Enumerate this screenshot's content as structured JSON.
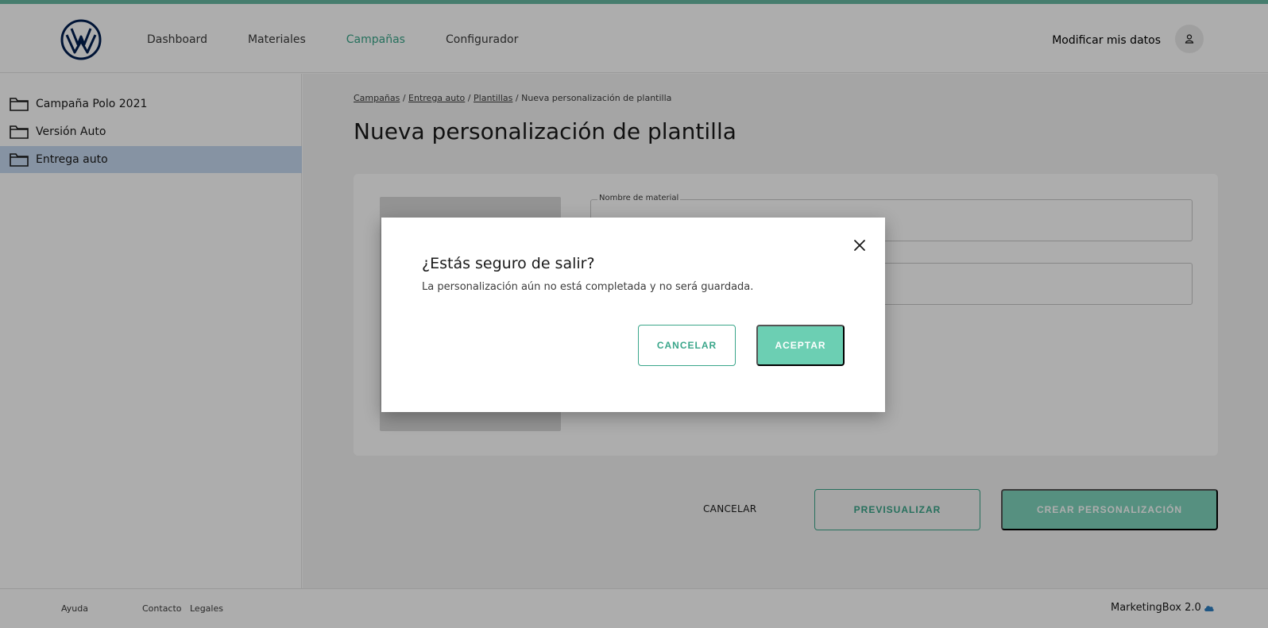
{
  "header": {
    "nav": [
      {
        "label": "Dashboard"
      },
      {
        "label": "Materiales"
      },
      {
        "label": "Campañas"
      },
      {
        "label": "Configurador"
      }
    ],
    "active_nav": "Campañas",
    "user_link": "Modificar mis datos"
  },
  "sidebar": {
    "items": [
      {
        "label": "Campaña Polo 2021"
      },
      {
        "label": "Versión Auto"
      },
      {
        "label": "Entrega auto"
      }
    ],
    "selected": "Entrega auto"
  },
  "breadcrumb": {
    "items": [
      "Campañas",
      "Entrega auto",
      "Plantillas"
    ],
    "separator": "/",
    "current": "Nueva personalización de plantilla"
  },
  "page": {
    "title": "Nueva personalización de plantilla"
  },
  "form": {
    "material_name_label": "Nombre de material"
  },
  "actions": {
    "cancel": "CANCELAR",
    "preview": "PREVISUALIZAR",
    "create": "CREAR PERSONALIZACIÓN"
  },
  "footer": {
    "links": [
      "Ayuda",
      "Contacto",
      "Legales"
    ],
    "brand": "MarketingBox 2.0"
  },
  "modal": {
    "title": "¿Estás seguro de salir?",
    "text": "La personalización aún no está completada y no será guardada.",
    "cancel": "CANCELAR",
    "accept": "ACEPTAR"
  },
  "colors": {
    "accent": "#3aa68a",
    "accent_light": "#6ccfb3",
    "brand_blue": "#001e50",
    "selected_bg": "#c6d9f0"
  },
  "icons": [
    "vw-logo-icon",
    "user-icon",
    "folder-icon",
    "close-icon",
    "cloud-icon"
  ]
}
